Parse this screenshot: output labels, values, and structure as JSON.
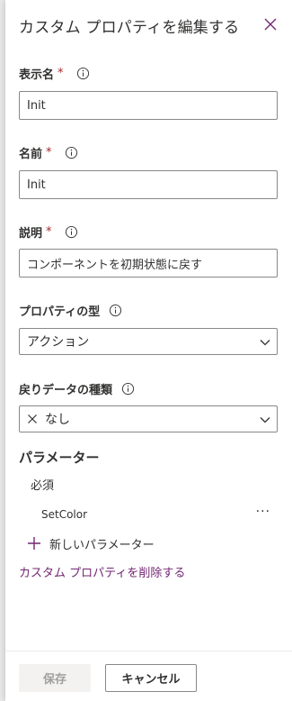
{
  "panel": {
    "title": "カスタム プロパティを編集する",
    "close_icon": "close-icon"
  },
  "display_name": {
    "label": "表示名",
    "required_mark": "*",
    "value": "Init"
  },
  "name": {
    "label": "名前",
    "required_mark": "*",
    "value": "Init"
  },
  "description": {
    "label": "説明",
    "required_mark": "*",
    "value": "コンポーネントを初期状態に戻す"
  },
  "property_type": {
    "label": "プロパティの型",
    "selected": "アクション"
  },
  "return_type": {
    "label": "戻りデータの種類",
    "selected": "なし"
  },
  "parameters": {
    "title": "パラメーター",
    "required_label": "必須",
    "items": [
      {
        "name": "SetColor",
        "more": "···"
      }
    ],
    "new_label": "新しいパラメーター"
  },
  "delete_link": "カスタム プロパティを削除する",
  "footer": {
    "save_label": "保存",
    "cancel_label": "キャンセル"
  },
  "colors": {
    "accent": "#742774",
    "required": "#a4262c",
    "border": "#8a8886",
    "disabled_bg": "#f3f2f1"
  }
}
